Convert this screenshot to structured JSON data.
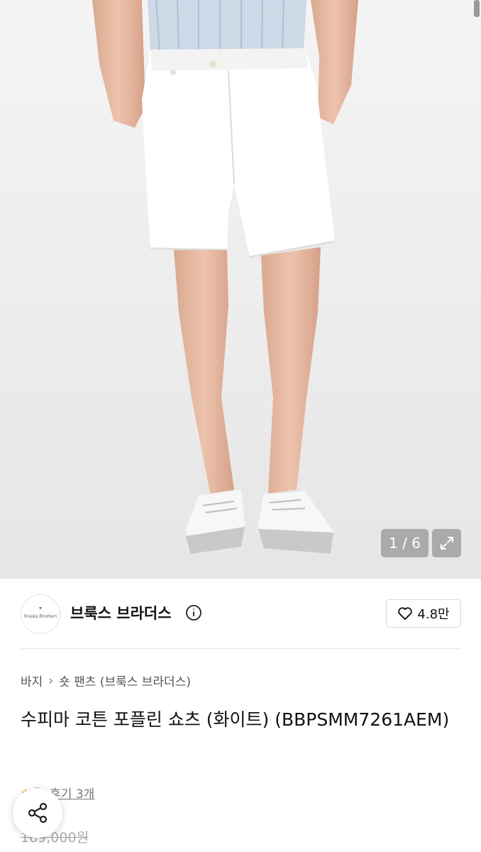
{
  "gallery": {
    "counter": "1 / 6",
    "image_alt": "White shorts worn with grey sneakers"
  },
  "brand": {
    "name": "브룩스 브라더스",
    "logo_text": "Brooks Brothers",
    "likes": "4.8만"
  },
  "breadcrumb": {
    "items": [
      "바지",
      "숏 팬츠 (브룩스 브라더스)"
    ]
  },
  "product": {
    "title": "수피마 코튼 포플린 쇼츠 (화이트) (BBPSMM7261AEM)",
    "rating": "5",
    "reviews": "후기 3개",
    "price": "169,000원"
  },
  "colors": {
    "accent_star": "#f5b400",
    "background": "#ffffff"
  }
}
